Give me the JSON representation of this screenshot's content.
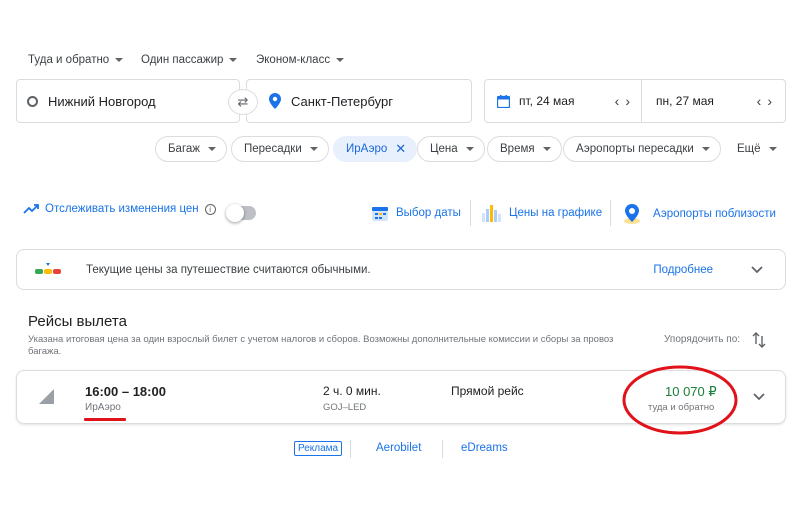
{
  "trip_options": {
    "trip_type": "Туда и обратно",
    "passengers": "Один пассажир",
    "cabin_class": "Эконом-класс"
  },
  "search": {
    "origin": "Нижний Новгород",
    "destination": "Санкт-Петербург",
    "depart_date": "пт, 24 мая",
    "return_date": "пн, 27 мая"
  },
  "filters": {
    "chips": [
      "Багаж",
      "Пересадки",
      "ИрАэро",
      "Цена",
      "Время",
      "Аэропорты пересадки",
      "Ещё"
    ],
    "selected": "ИрАэро"
  },
  "tools": {
    "track_prices": "Отслеживать изменения цен",
    "date_grid": "Выбор даты",
    "price_graph": "Цены на графике",
    "nearby_airports": "Аэропорты поблизости"
  },
  "price_insight": {
    "text": "Текущие цены за путешествие считаются обычными.",
    "more_link": "Подробнее"
  },
  "results": {
    "title": "Рейсы вылета",
    "subtitle": "Указана итоговая цена за один взрослый билет с учетом налогов и сборов. Возможны дополнительные комиссии и сборы за провоз багажа.",
    "sort_label": "Упорядочить по:"
  },
  "flight": {
    "times": "16:00 – 18:00",
    "airline": "ИрАэро",
    "duration": "2 ч. 0 мин.",
    "route": "GOJ–LED",
    "stops": "Прямой рейс",
    "price": "10 070 ₽",
    "price_note": "туда и обратно"
  },
  "footer": {
    "ad_label": "Реклама",
    "links": [
      "Aerobilet",
      "eDreams"
    ]
  },
  "colors": {
    "accent": "#1a73e8",
    "price_green": "#188038",
    "annotation_red": "#e0131b"
  }
}
